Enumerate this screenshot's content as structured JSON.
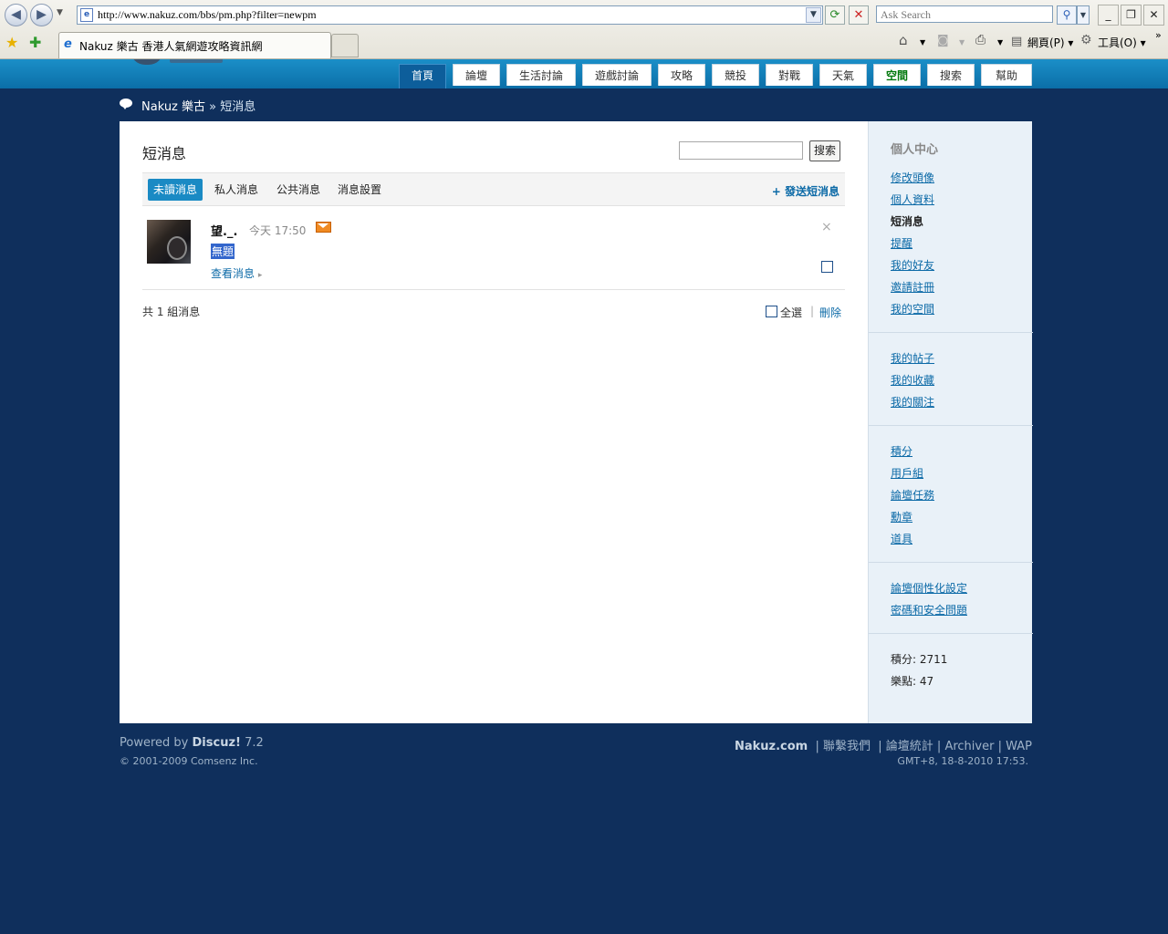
{
  "browser": {
    "url": "http://www.nakuz.com/bbs/pm.php?filter=newpm",
    "search_placeholder": "Ask Search",
    "tab_title": "Nakuz 樂古 香港人氣網遊攻略資訊網",
    "page_menu": "網頁(P)",
    "tools_menu": "工具(O)"
  },
  "nav": {
    "items": [
      "首頁",
      "論壇",
      "生活討論",
      "遊戲討論",
      "攻略",
      "競投",
      "對戰",
      "天氣",
      "空間",
      "搜索",
      "幫助"
    ]
  },
  "breadcrumb": {
    "home": "Nakuz 樂古",
    "sep": "»",
    "current": "短消息"
  },
  "pm": {
    "title": "短消息",
    "search_button": "搜索",
    "tabs": [
      "未讀消息",
      "私人消息",
      "公共消息",
      "消息設置"
    ],
    "send_link": "+ 發送短消息",
    "message": {
      "sender": "望._.",
      "time": "今天 17:50",
      "subject": "無題",
      "view_link": "查看消息",
      "delete": "×"
    },
    "count": "共 1 組消息",
    "select_all": "全選",
    "separator": "|",
    "delete_link": "刪除"
  },
  "sidebar": {
    "title": "個人中心",
    "group1": [
      "修改頭像",
      "個人資料",
      "短消息",
      "提醒",
      "我的好友",
      "邀請註冊",
      "我的空間"
    ],
    "group2": [
      "我的帖子",
      "我的收藏",
      "我的關注"
    ],
    "group3": [
      "積分",
      "用戶組",
      "論壇任務",
      "勳章",
      "道具"
    ],
    "group4": [
      "論壇個性化設定",
      "密碼和安全問題"
    ],
    "stats": [
      "積分: 2711",
      "樂點: 47"
    ]
  },
  "footer": {
    "powered": "Powered by",
    "brand": "Discuz!",
    "version": "7.2",
    "copyright": "© 2001-2009 Comsenz Inc.",
    "site": "Nakuz.com",
    "links": [
      "聯繫我們",
      "論壇統計",
      "Archiver",
      "WAP"
    ],
    "time": "GMT+8, 18-8-2010 17:53."
  }
}
